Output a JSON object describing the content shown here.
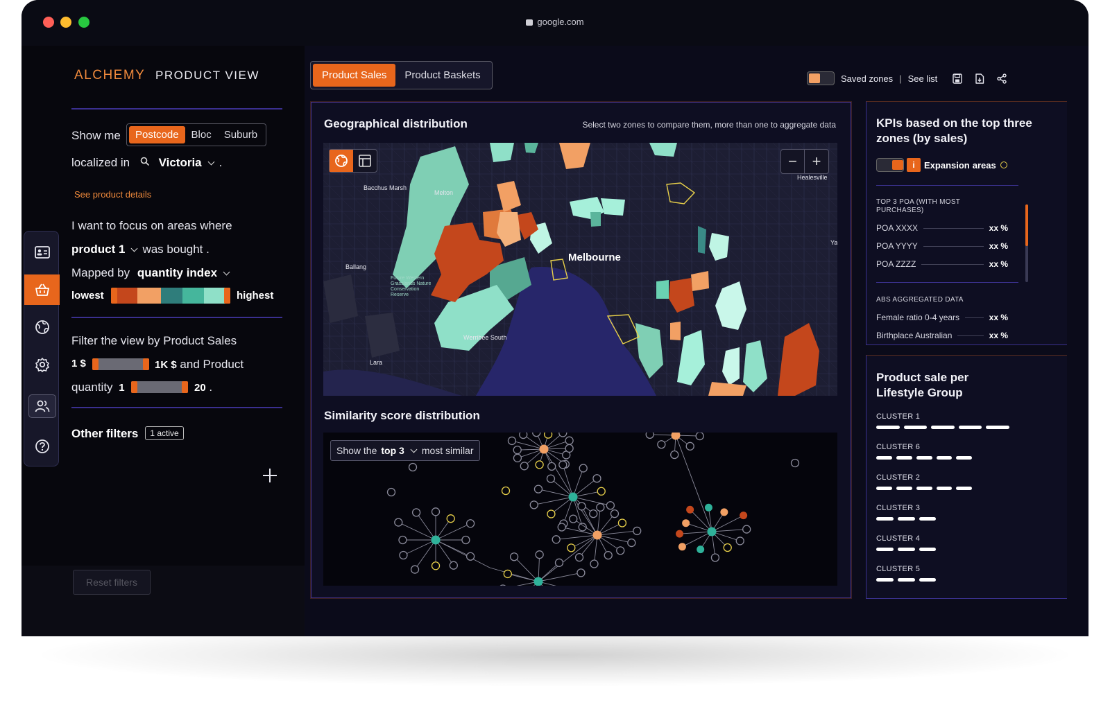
{
  "browser": {
    "url": "google.com"
  },
  "brand": {
    "logo": "ALCHEMY",
    "view": "PRODUCT VIEW"
  },
  "showme": {
    "label": "Show me",
    "options": [
      "Postcode",
      "Bloc",
      "Suburb"
    ],
    "selected": "Postcode"
  },
  "localized": {
    "label": "localized in",
    "value": "Victoria",
    "suffix": "."
  },
  "product_link": "See product details",
  "focus": {
    "intro": "I want to focus on areas where",
    "product": "product 1",
    "verb": "was bought",
    "period": ".",
    "mapped_label": "Mapped by",
    "mapped_value": "quantity index",
    "low": "lowest",
    "high": "highest"
  },
  "filter": {
    "title": "Filter the view by Product Sales",
    "min_price": "1 $",
    "max_price": "1K $",
    "and_product": "and Product",
    "qty_label": "quantity",
    "qty_min": "1",
    "qty_max": "20",
    "period": "."
  },
  "other_filters": {
    "label": "Other filters",
    "badge": "1 active"
  },
  "reset": "Reset filters",
  "rail": [
    {
      "icon": "id-card-icon",
      "active": false
    },
    {
      "icon": "basket-icon",
      "active": true
    },
    {
      "icon": "globe-icon",
      "active": false
    },
    {
      "icon": "settings-icon",
      "active": false
    },
    {
      "icon": "users-icon",
      "active": false
    },
    {
      "icon": "help-icon",
      "active": false
    }
  ],
  "tabs": [
    "Product Sales",
    "Product Baskets"
  ],
  "active_tab": "Product Sales",
  "toolbar": {
    "saved": "Saved zones",
    "sep": "|",
    "see_list": "See list"
  },
  "geo": {
    "title": "Geographical distribution",
    "hint": "Select two zones to compare them, more than one to aggregate data",
    "zoom_out": "−",
    "zoom_in": "+",
    "places": {
      "bacchus": "Bacchus Marsh",
      "melton": "Melton",
      "healesville": "Healesville",
      "melbourne": "Melbourne",
      "ballang": "Ballang",
      "future": "Future Western Grasslands Nature Conservation Reserve",
      "werribee": "Werribee South",
      "lara": "Lara",
      "ya": "Ya"
    }
  },
  "similarity": {
    "title": "Similarity score distribution",
    "prefix": "Show the",
    "value": "top 3",
    "suffix": "most similar"
  },
  "kpi": {
    "title": "KPIs based on the top three zones (by sales)",
    "expansion": "Expansion",
    "areas": "areas",
    "section1": "TOP 3 POA (WITH MOST PURCHASES)",
    "poa": [
      {
        "name": "POA XXXX",
        "value": "xx %"
      },
      {
        "name": "POA YYYY",
        "value": "xx %"
      },
      {
        "name": "POA ZZZZ",
        "value": "xx %"
      }
    ],
    "section2": "ABS AGGREGATED DATA",
    "abs": [
      {
        "name": "Female ratio 0-4 years",
        "value": "xx %"
      },
      {
        "name": "Birthplace Australian",
        "value": "xx %"
      }
    ]
  },
  "lifestyle": {
    "title": "Product sale per Lifestyle Group",
    "clusters": [
      {
        "name": "CLUSTER 1",
        "level": 1.0
      },
      {
        "name": "CLUSTER 6",
        "level": 0.72
      },
      {
        "name": "CLUSTER 2",
        "level": 0.72
      },
      {
        "name": "CLUSTER 3",
        "level": 0.45
      },
      {
        "name": "CLUSTER 4",
        "level": 0.45
      },
      {
        "name": "CLUSTER 5",
        "level": 0.45
      }
    ]
  },
  "colors": {
    "accent": "#e8661c",
    "panel_border": "#3b318f",
    "teal": "#8fe0c8",
    "rust": "#c4471c"
  }
}
